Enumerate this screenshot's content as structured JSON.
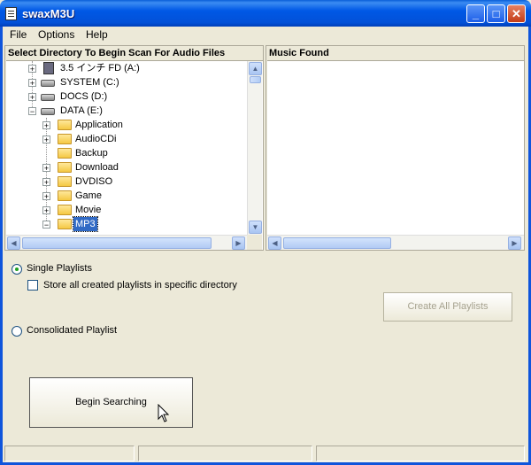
{
  "window": {
    "title": "swaxM3U"
  },
  "menu": {
    "file": "File",
    "options": "Options",
    "help": "Help"
  },
  "left_panel": {
    "header": "Select Directory To Begin Scan For Audio Files",
    "tree": [
      {
        "label": "3.5 インチ FD (A:)",
        "icon": "floppy-icon"
      },
      {
        "label": "SYSTEM (C:)",
        "icon": "drive-icon"
      },
      {
        "label": "DOCS (D:)",
        "icon": "drive-icon"
      },
      {
        "label": "DATA (E:)",
        "icon": "drive-icon"
      },
      {
        "label": "Application",
        "icon": "folder-icon"
      },
      {
        "label": "AudioCDi",
        "icon": "folder-icon"
      },
      {
        "label": "Backup",
        "icon": "folder-icon"
      },
      {
        "label": "Download",
        "icon": "folder-icon"
      },
      {
        "label": "DVDISO",
        "icon": "folder-icon"
      },
      {
        "label": "Game",
        "icon": "folder-icon"
      },
      {
        "label": "Movie",
        "icon": "folder-icon"
      },
      {
        "label": "MP3",
        "icon": "folder-open-icon",
        "selected": true
      }
    ]
  },
  "right_panel": {
    "header": "Music Found"
  },
  "options": {
    "single_playlists": "Single Playlists",
    "store_all": "Store all created playlists in specific directory",
    "consolidated": "Consolidated Playlist",
    "create_all": "Create All Playlists",
    "begin": "Begin Searching"
  },
  "colors": {
    "titlebar": "#0058e6",
    "face": "#ece9d8",
    "selection": "#316ac5"
  }
}
